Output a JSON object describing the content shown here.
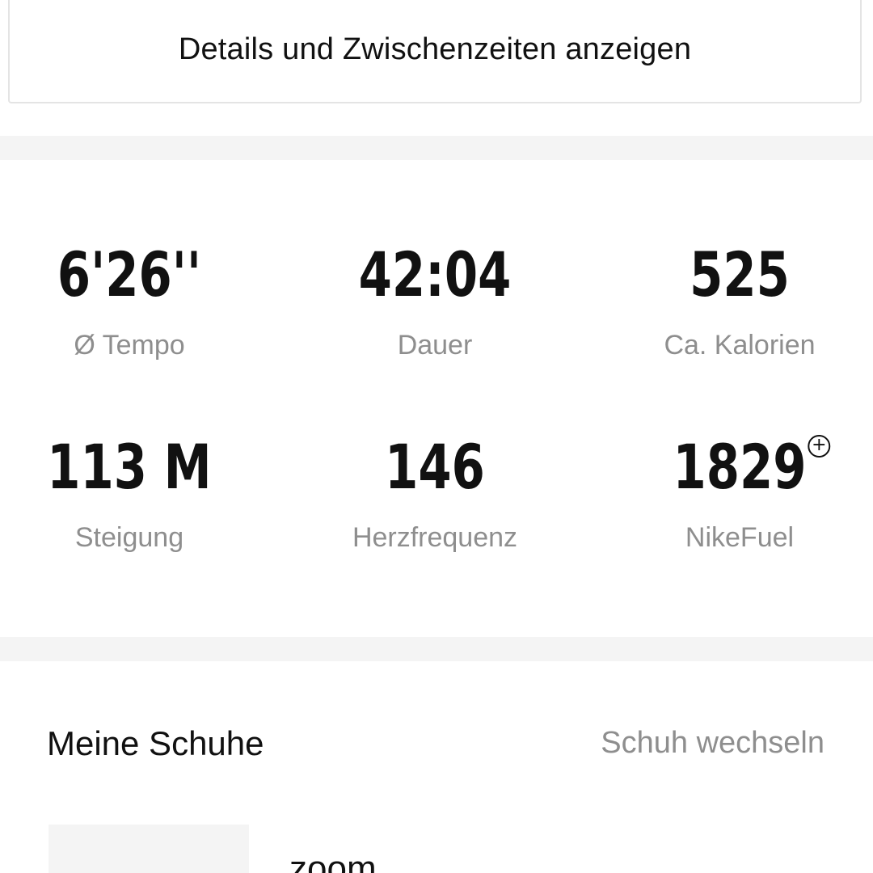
{
  "details": {
    "button_label": "Details und Zwischenzeiten anzeigen"
  },
  "stats": {
    "pace": {
      "value": "6'26''",
      "label": "Ø Tempo"
    },
    "duration": {
      "value": "42:04",
      "label": "Dauer"
    },
    "calories": {
      "value": "525",
      "label": "Ca. Kalorien"
    },
    "elevation": {
      "value": "113 M",
      "label": "Steigung"
    },
    "heart_rate": {
      "value": "146",
      "label": "Herzfrequenz"
    },
    "nikefuel": {
      "value": "1829",
      "label": "NikeFuel",
      "icon": "fuel-plus-icon",
      "icon_glyph": "+"
    }
  },
  "shoes": {
    "title": "Meine Schuhe",
    "change_label": "Schuh wechseln",
    "item_name": "zoom"
  },
  "colors": {
    "text_primary": "#111111",
    "text_secondary": "#8e8e8e",
    "divider": "#f4f4f4",
    "border": "#e4e4e4"
  }
}
